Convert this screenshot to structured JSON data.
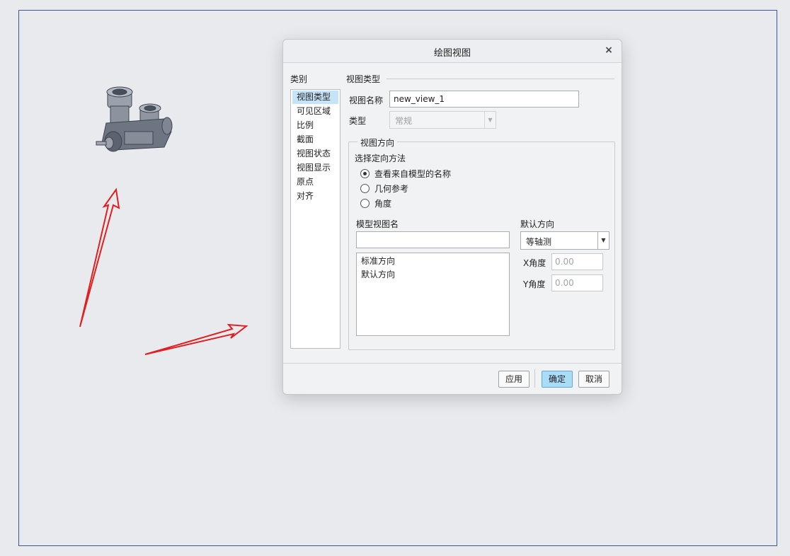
{
  "dialog": {
    "title": "绘图视图",
    "close_glyph": "×",
    "categories_label": "类别",
    "categories": [
      "视图类型",
      "可见区域",
      "比例",
      "截面",
      "视图状态",
      "视图显示",
      "原点",
      "对齐"
    ],
    "section_title": "视图类型",
    "view_name_label": "视图名称",
    "view_name_value": "new_view_1",
    "type_label": "类型",
    "type_value": "常规",
    "orientation_group_title": "视图方向",
    "method_label": "选择定向方法",
    "methods": [
      {
        "label": "查看来自模型的名称",
        "checked": true
      },
      {
        "label": "几何参考",
        "checked": false
      },
      {
        "label": "角度",
        "checked": false
      }
    ],
    "model_view_name_label": "模型视图名",
    "model_view_name_value": "",
    "model_views": [
      "标准方向",
      "默认方向"
    ],
    "default_orientation_label": "默认方向",
    "default_orientation_value": "等轴测",
    "x_angle_label": "X角度",
    "x_angle_value": "0.00",
    "y_angle_label": "Y角度",
    "y_angle_value": "0.00",
    "buttons": {
      "apply": "应用",
      "ok": "确定",
      "cancel": "取消"
    }
  },
  "colors": {
    "sheet_border": "#3a5a9a",
    "annotation_arrow": "#e02020",
    "selected_category": "#c6e4f7",
    "primary_button": "#a9dcf7"
  },
  "icons": [
    "model-thumbnail-icon",
    "close-icon",
    "dropdown-arrow-icon"
  ]
}
